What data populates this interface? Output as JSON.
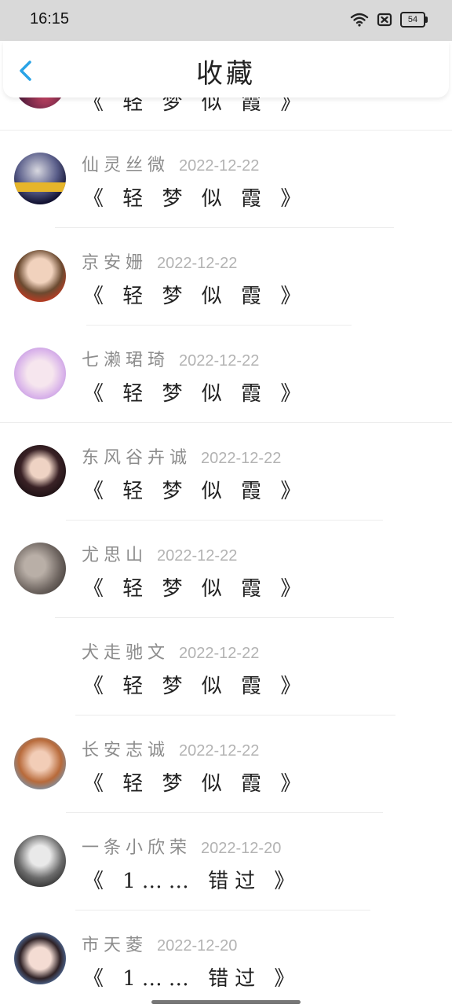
{
  "status_bar": {
    "time": "16:15",
    "battery": "54"
  },
  "header": {
    "title": "收藏"
  },
  "partial_item": {
    "poem": "《 轻 梦 似 霞 》"
  },
  "items": [
    {
      "name": "仙灵丝微",
      "date": "2022-12-22",
      "poem": "《 轻 梦 似 霞 》"
    },
    {
      "name": "京安姗",
      "date": "2022-12-22",
      "poem": "《 轻 梦 似 霞 》"
    },
    {
      "name": "七濑珺琦",
      "date": "2022-12-22",
      "poem": "《 轻 梦 似 霞 》"
    },
    {
      "name": "东风谷卉诚",
      "date": "2022-12-22",
      "poem": "《 轻 梦 似 霞 》"
    },
    {
      "name": "尤思山",
      "date": "2022-12-22",
      "poem": "《 轻 梦 似 霞 》"
    },
    {
      "name": "犬走驰文",
      "date": "2022-12-22",
      "poem": "《 轻 梦 似 霞 》"
    },
    {
      "name": "长安志诚",
      "date": "2022-12-22",
      "poem": "《 轻 梦 似 霞 》"
    },
    {
      "name": "一条小欣荣",
      "date": "2022-12-20",
      "poem": "《 1…… 错过 》"
    },
    {
      "name": "市天菱",
      "date": "2022-12-20",
      "poem": "《 1…… 错过 》"
    }
  ],
  "colors": {
    "accent": "#29a3e6",
    "name_text": "#8c8c8c",
    "date_text": "#b3b3b3"
  }
}
